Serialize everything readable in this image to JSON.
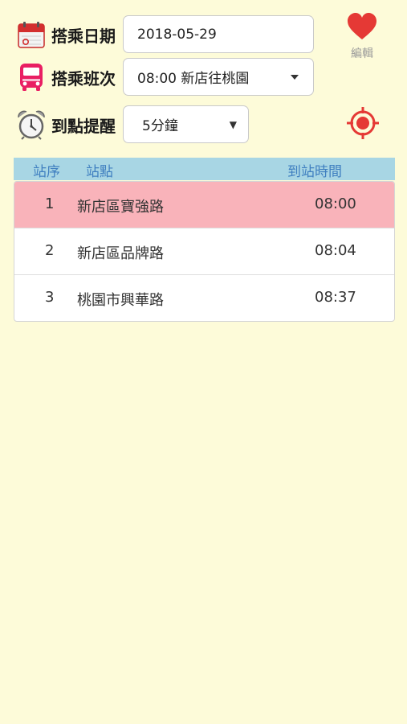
{
  "form": {
    "date_label": "搭乘日期",
    "date_value": "2018-05-29",
    "trip_label": "搭乘班次",
    "trip_value": "08:00 新店往桃園",
    "reminder_label": "到點提醒",
    "reminder_value": "5分鐘"
  },
  "actions": {
    "edit_label": "編輯"
  },
  "table": {
    "headers": {
      "seq": "站序",
      "stop": "站點",
      "time": "到站時間"
    },
    "rows": [
      {
        "seq": "1",
        "stop": "新店區寶強路",
        "time": "08:00",
        "highlighted": true
      },
      {
        "seq": "2",
        "stop": "新店區品牌路",
        "time": "08:04",
        "highlighted": false
      },
      {
        "seq": "3",
        "stop": "桃園市興華路",
        "time": "08:37",
        "highlighted": false
      }
    ]
  },
  "icons": {
    "date": "calendar-icon",
    "trip": "bus-icon",
    "reminder": "alarm-clock-icon",
    "favorite": "heart-icon",
    "locate": "crosshair-icon"
  },
  "colors": {
    "background": "#fdfbd9",
    "header_bg": "#a8d6e4",
    "header_text": "#3f7fc0",
    "highlight_row": "#f9b3ba",
    "accent_red": "#e53935"
  }
}
